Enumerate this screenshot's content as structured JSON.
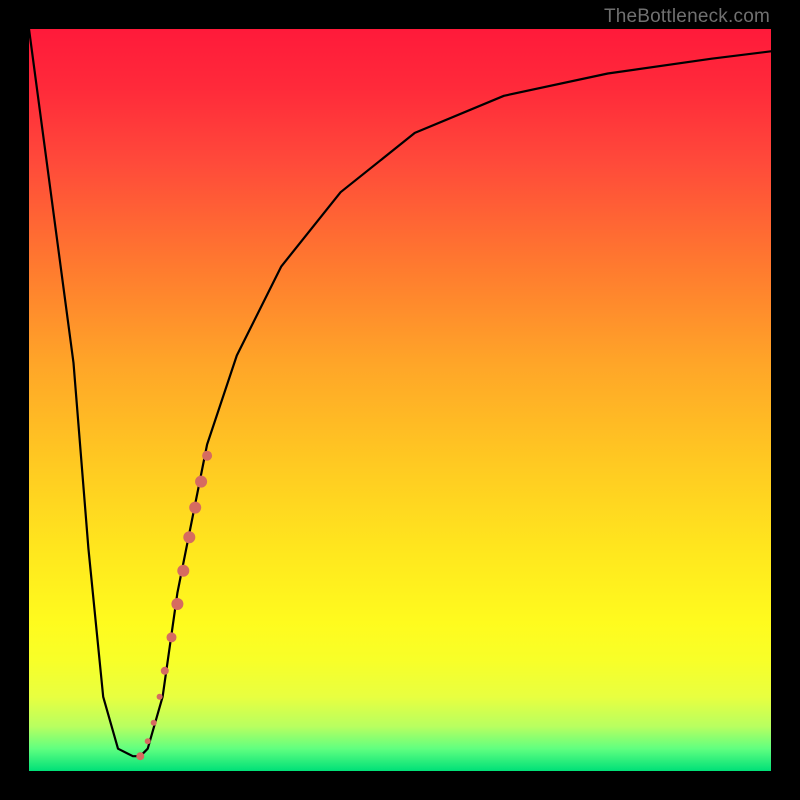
{
  "watermark": "TheBottleneck.com",
  "chart_data": {
    "type": "line",
    "title": "",
    "xlabel": "",
    "ylabel": "",
    "xlim": [
      0,
      100
    ],
    "ylim": [
      0,
      100
    ],
    "series": [
      {
        "name": "bottleneck-curve",
        "x": [
          0,
          6,
          8,
          10,
          12,
          14,
          15,
          16,
          18,
          20,
          24,
          28,
          34,
          42,
          52,
          64,
          78,
          92,
          100
        ],
        "values": [
          100,
          55,
          30,
          10,
          3,
          2,
          2,
          3,
          10,
          24,
          44,
          56,
          68,
          78,
          86,
          91,
          94,
          96,
          97
        ]
      }
    ],
    "marker_band": {
      "name": "highlighted-data-range",
      "color": "#d66b60",
      "points": [
        {
          "x": 15.0,
          "y": 2.0,
          "r": 4
        },
        {
          "x": 16.0,
          "y": 4.0,
          "r": 3
        },
        {
          "x": 16.8,
          "y": 6.5,
          "r": 3
        },
        {
          "x": 17.6,
          "y": 10.0,
          "r": 3
        },
        {
          "x": 18.3,
          "y": 13.5,
          "r": 4
        },
        {
          "x": 19.2,
          "y": 18.0,
          "r": 5
        },
        {
          "x": 20.0,
          "y": 22.5,
          "r": 6
        },
        {
          "x": 20.8,
          "y": 27.0,
          "r": 6
        },
        {
          "x": 21.6,
          "y": 31.5,
          "r": 6
        },
        {
          "x": 22.4,
          "y": 35.5,
          "r": 6
        },
        {
          "x": 23.2,
          "y": 39.0,
          "r": 6
        },
        {
          "x": 24.0,
          "y": 42.5,
          "r": 5
        }
      ]
    },
    "gradient_stops": [
      {
        "pos": 0,
        "color": "#ff1a3a"
      },
      {
        "pos": 50,
        "color": "#ffc822"
      },
      {
        "pos": 85,
        "color": "#fffb1e"
      },
      {
        "pos": 100,
        "color": "#00e078"
      }
    ]
  }
}
